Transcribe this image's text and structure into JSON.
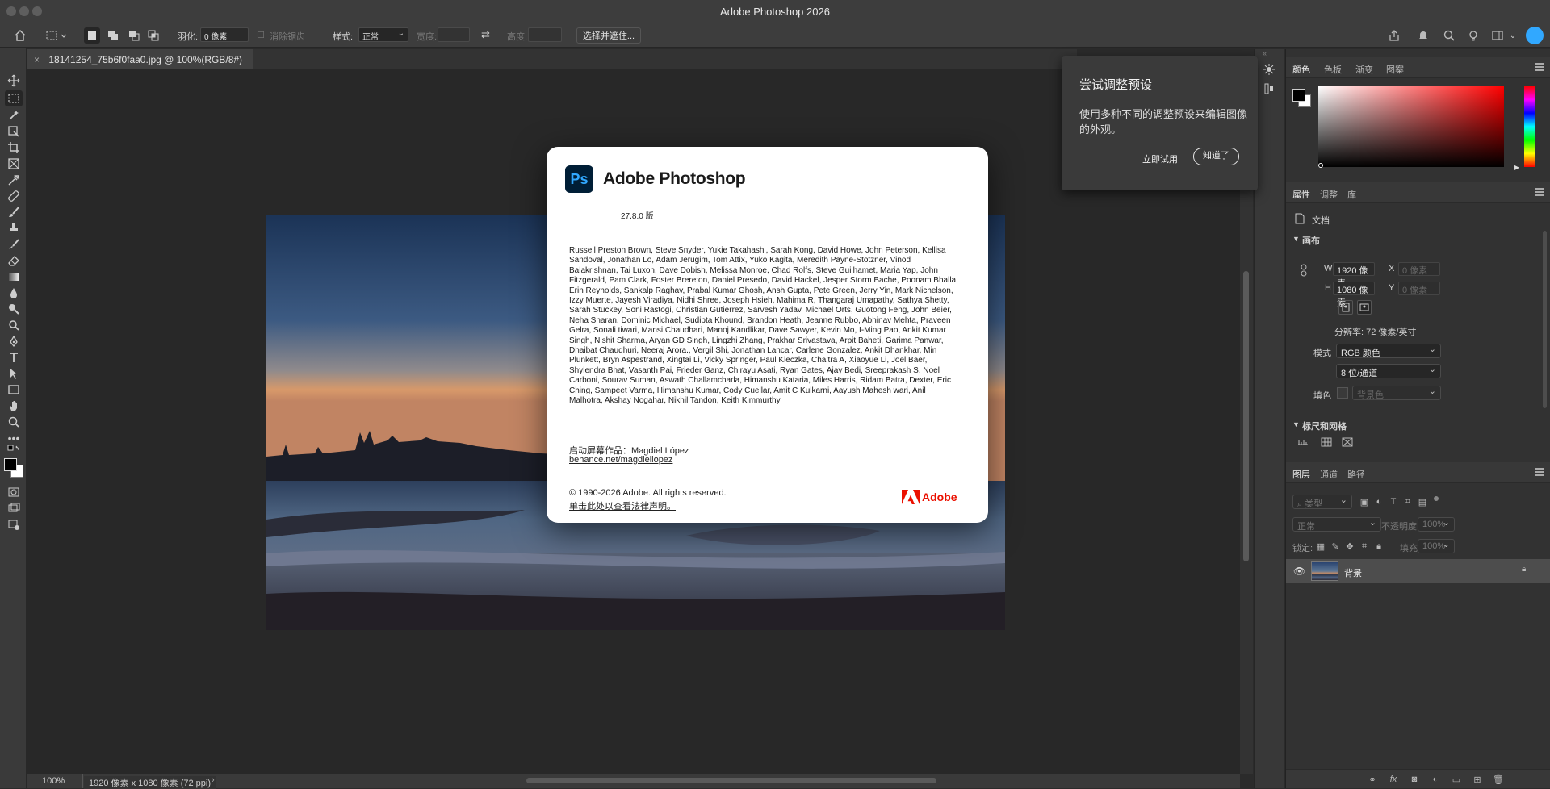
{
  "app": {
    "title": "Adobe Photoshop 2026"
  },
  "options_bar": {
    "feather_label": "羽化:",
    "feather_value": "0 像素",
    "antialias_label": "消除锯齿",
    "style_label": "样式:",
    "style_value": "正常",
    "width_label": "宽度:",
    "height_label": "高度:",
    "select_mask_button": "选择并遮住..."
  },
  "document_tab": {
    "name": "18141254_75b6f0faa0.jpg @ 100%(RGB/8#)"
  },
  "status_bar": {
    "zoom": "100%",
    "doc_info": "1920 像素 x 1080 像素 (72 ppi)"
  },
  "tip_popover": {
    "title": "尝试调整预设",
    "body": "使用多种不同的调整预设来编辑图像的外观。",
    "try_button": "立即试用",
    "got_it_button": "知道了"
  },
  "about_dialog": {
    "product_name": "Adobe Photoshop",
    "logo_text": "Ps",
    "version": "27.8.0 版",
    "credits": "Russell Preston Brown, Steve Snyder, Yukie Takahashi, Sarah Kong, David Howe, John Peterson, Kellisa Sandoval, Jonathan Lo, Adam Jerugim, Tom Attix, Yuko Kagita, Meredith Payne-Stotzner, Vinod Balakrishnan, Tai Luxon, Dave Dobish, Melissa Monroe, Chad Rolfs, Steve Guilhamet, Maria Yap, John Fitzgerald, Pam Clark, Foster Brereton, Daniel Presedo, David Hackel, Jesper Storm Bache, Poonam Bhalla, Erin Reynolds, Sankalp Raghav, Prabal Kumar Ghosh, Ansh Gupta, Pete Green, Jerry Yin, Mark Nichelson, Izzy Muerte, Jayesh Viradiya, Nidhi Shree, Joseph Hsieh, Mahima R, Thangaraj Umapathy, Sathya Shetty, Sarah Stuckey, Soni Rastogi, Christian Gutierrez, Sarvesh Yadav, Michael Orts, Guotong Feng, John Beier, Neha Sharan, Dominic Michael, Sudipta Khound, Brandon Heath, Jeanne Rubbo, Abhinav Mehta, Praveen Gelra, Sonali tiwari, Mansi Chaudhari, Manoj Kandlikar, Dave Sawyer, Kevin Mo, I-Ming Pao, Ankit Kumar Singh, Nishit Sharma, Aryan GD Singh, Lingzhi Zhang, Prakhar Srivastava, Arpit Baheti, Garima Panwar, Dhaibat Chaudhuri, Neeraj Arora., Vergil Shi, Jonathan Lancar, Carlene Gonzalez, Ankit Dhankhar, Min Plunkett, Bryn Aspestrand, Xingtai Li, Vicky Springer, Paul Kleczka, Chaitra A, Xiaoyue Li, Joel Baer, Shylendra Bhat, Vasanth Pai, Frieder Ganz, Chirayu Asati, Ryan Gates, Ajay Bedi, Sreeprakash S, Noel Carboni, Sourav Suman, Aswath Challamcharla, Himanshu Kataria, Miles Harris, Ridam Batra, Dexter, Eric Ching, Sampeet Varma, Himanshu Kumar, Cody Cuellar, Amit C Kulkarni, Aayush Mahesh wari, Anil Malhotra, Akshay Nogahar, Nikhil Tandon, Keith Kimmurthy",
    "splash_label": "启动屏幕作品：Magdiel López",
    "splash_link": "behance.net/magdiellopez",
    "copyright": "© 1990-2026 Adobe. All rights reserved.",
    "legal_link": "单击此处以查看法律声明。",
    "adobe_wordmark": "Adobe"
  },
  "color_panel": {
    "tabs": [
      "颜色",
      "色板",
      "渐变",
      "图案"
    ]
  },
  "properties_panel": {
    "tabs": [
      "属性",
      "调整",
      "库"
    ],
    "doc_label": "文档",
    "canvas_section": "画布",
    "w_label": "W",
    "w_value": "1920 像素",
    "h_label": "H",
    "h_value": "1080 像素",
    "x_label": "X",
    "x_placeholder": "0 像素",
    "y_label": "Y",
    "y_placeholder": "0 像素",
    "resolution": "分辨率: 72 像素/英寸",
    "mode_label": "模式",
    "mode_value": "RGB 颜色",
    "depth_value": "8 位/通道",
    "fill_label": "填色",
    "fill_value": "背景色",
    "rulers_section": "标尺和网格"
  },
  "layers_panel": {
    "tabs": [
      "图层",
      "通道",
      "路径"
    ],
    "filter_placeholder": "类型",
    "blend_mode": "正常",
    "opacity_label": "不透明度:",
    "opacity_value": "100%",
    "lock_label": "锁定:",
    "fill_label": "填充:",
    "fill_value": "100%",
    "layers": [
      {
        "name": "背景"
      }
    ]
  },
  "colors": {
    "accent": "#31a8ff",
    "adobe_red": "#eb1000",
    "ps_blue": "#001e36"
  }
}
